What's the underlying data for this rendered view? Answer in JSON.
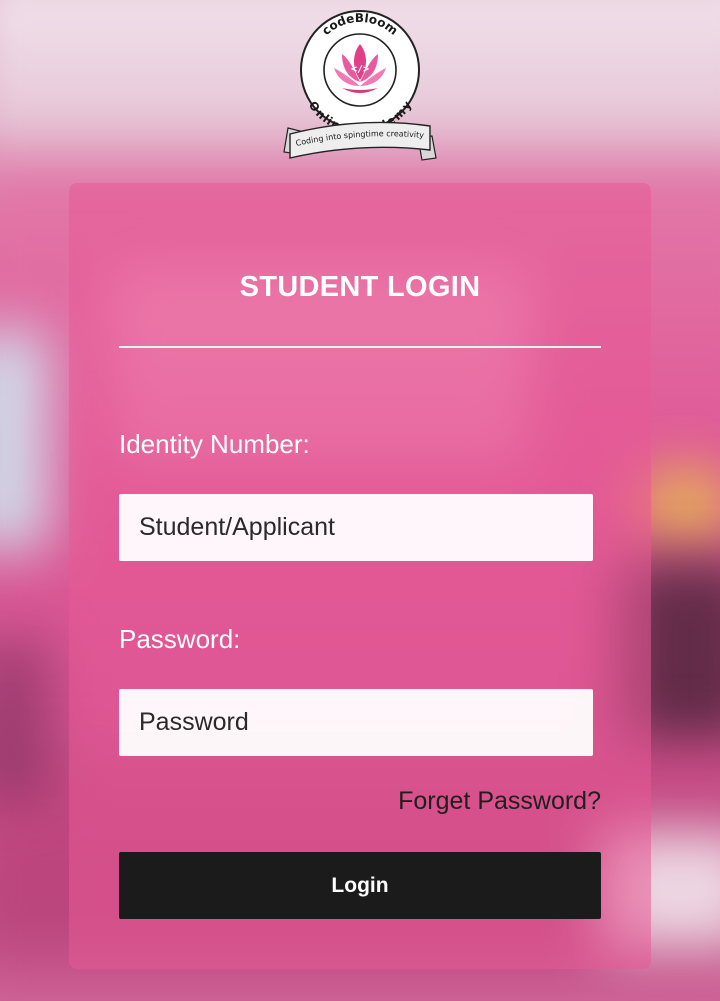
{
  "logo": {
    "brand": "codeBloom",
    "name": "Online Academy",
    "tagline": "Coding into spingtime creativity",
    "icon": "lotus-icon"
  },
  "login": {
    "title": "STUDENT LOGIN",
    "identity_label": "Identity Number:",
    "identity_placeholder": "Student/Applicant",
    "identity_value": "",
    "password_label": "Password:",
    "password_placeholder": "Password",
    "password_value": "",
    "forget_link": "Forget Password?",
    "submit_label": "Login"
  },
  "colors": {
    "card": "#e85a96",
    "divider": "#d9f5ea",
    "button": "#1b1b1b",
    "text_light": "#ffffff"
  }
}
